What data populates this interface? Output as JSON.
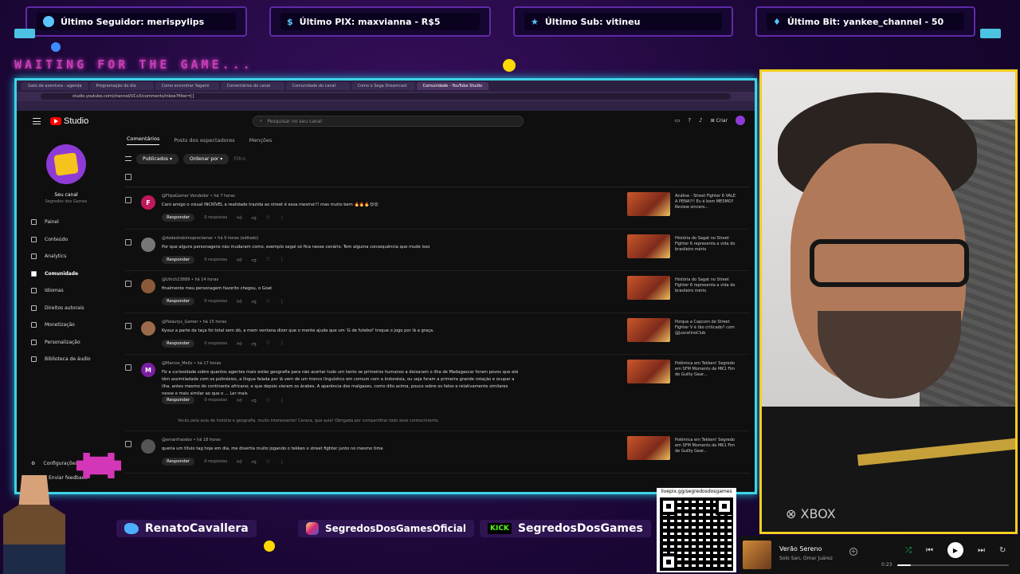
{
  "alerts": [
    {
      "label": "Último Seguidor: merispylips"
    },
    {
      "label": "Último PIX: maxvianna - R$5"
    },
    {
      "label": "Último Sub: vitineu"
    },
    {
      "label": "Último Bit: yankee_channel - 50"
    }
  ],
  "overlay": {
    "waiting_text": "WAITING FOR THE GAME..."
  },
  "browser": {
    "tabs": [
      "Gato de aventura - agenda",
      "Programação do dia",
      "Como encontrar Yagami",
      "Comentários do canal",
      "Comunidade do canal",
      "Como o Sega Dreamcast",
      "Comunidade - YouTube Studio"
    ],
    "url": "studio.youtube.com/channel/UCxX/comments/inbox?filter=[]"
  },
  "studio": {
    "logo": "Studio",
    "search_placeholder": "Pesquisar no seu canal",
    "create_label": "Criar",
    "channel_label": "Seu canal",
    "channel_name": "Segredos dos Games",
    "nav": [
      {
        "label": "Painel",
        "icon": "dashboard-icon"
      },
      {
        "label": "Conteúdo",
        "icon": "content-icon"
      },
      {
        "label": "Analytics",
        "icon": "analytics-icon"
      },
      {
        "label": "Comunidade",
        "icon": "community-icon"
      },
      {
        "label": "Idiomas",
        "icon": "language-icon"
      },
      {
        "label": "Direitos autorais",
        "icon": "copyright-icon"
      },
      {
        "label": "Monetização",
        "icon": "money-icon"
      },
      {
        "label": "Personalização",
        "icon": "customize-icon"
      },
      {
        "label": "Biblioteca de áudio",
        "icon": "audio-library-icon"
      }
    ],
    "settings_label": "Configurações",
    "feedback_label": "Enviar feedback",
    "tabs": [
      "Comentários",
      "Posts dos espectadores",
      "Menções"
    ],
    "filters": {
      "published": "Publicados",
      "sort": "Ordenar por",
      "filter_placeholder": "Filtro"
    },
    "reply_label": "Responder",
    "replies_label": "0 respostas",
    "comments": [
      {
        "avatar_letter": "F",
        "avatar_color": "#c2185b",
        "author": "@FlipaGamer Vendedor • há 7 horas",
        "text": "Caro amigo o visual INCRÍVEL a realidade trazida ao street é essa mesma!!! mas muito bem 🔥🔥🔥😍😍",
        "video": "Análise - Street Fighter 6 VALE A PENA?!! Eu é bom MESMO? Review sincero..."
      },
      {
        "avatar_letter": "",
        "avatar_color": "#777777",
        "author": "@dadashobimoproclamar • há 9 horas (editado)",
        "text": "Por que alguns personagens não mudaram como, exemplo segal só fica nesse cenário. Tem alguma consequência que mude isso",
        "video": "História do Sagat no Street Fighter 6 representa a vida do brasileiro mério"
      },
      {
        "avatar_letter": "",
        "avatar_color": "#8a5a3a",
        "author": "@Ulrich23889 • há 14 horas",
        "text": "finalmente meu personagem favorito chegou, o Goat",
        "video": "História do Sagat no Street Fighter 6 representa a vida do brasileiro mério"
      },
      {
        "avatar_letter": "",
        "avatar_color": "#9a6a4a",
        "author": "@Palautys_Gamer • há 15 horas",
        "text": "Kyouz a parte da taça foi total sem dó, a mem ventana dizer que o mente ajuda que um 'G de futebol' troque o jogo por lá a graça.",
        "video": "Porque a Capcom de Street Fighter V é tão criticado? com @JuscelinoClub"
      },
      {
        "avatar_letter": "M",
        "avatar_color": "#7b1fa2",
        "author": "@Marcos_Mello • há 17 horas",
        "text": "Fiz a curiosidade sobre quantos agentes mais estão geografia para não acertar tudo um tanto se primeiros humanos a deixaram o ilha de Madagascar foram povos que até têm assimiladade com os polinésios, a língua falada por lá vem de um tronco linguístico em comum com a Indonésia, ou seja foram a primeira grande rotação e ocupar a ilha, antes mesmo do continente africano; e que depois vieram os árabes. A aparência dos malgaxes, como dito acima, pouco sobre os fatos e relativamente similares nesse e mais similar ao que o ... Ler mais",
        "video": "Polêmica em Tekken! Segredo em SFM Moments de MK1 Fim de Guilty Gear...",
        "reply_strip": "Vocês pela aula de história e geografia, muito interessante!   Caraca, que aula! Obrigada por compartilhar todo esse conhecimento."
      },
      {
        "avatar_letter": "",
        "avatar_color": "#555555",
        "author": "@emanfraodos • há 18 horas",
        "text": "queria um título tag hoje em dia, me divertia muito jogando o tekken x street fighter junto no mesmo time",
        "video": "Polêmica em Tekken! Segredo em SFM Moments de MK1 Fim de Guilty Gear..."
      }
    ]
  },
  "socials": [
    {
      "icon": "twitter-icon",
      "label": "RenatoCavallera"
    },
    {
      "icon": "instagram-icon",
      "label": "SegredosDosGamesOficial"
    },
    {
      "icon": "kick-icon",
      "badge": "KICK",
      "label": "SegredosDosGames"
    }
  ],
  "qr": {
    "label": "livepix.gg/segredosdosgames"
  },
  "player": {
    "song": "Verão Sereno",
    "artist": "Solo San, Omar Juárez",
    "time_elapsed": "0:23",
    "progress": 0.12,
    "plus": "+"
  },
  "colors": {
    "accent_cyan": "#3ed3e8",
    "webcam_border": "#f2cf1e",
    "bg_purple": "#1b0736",
    "youtube_red": "#ff0000"
  }
}
